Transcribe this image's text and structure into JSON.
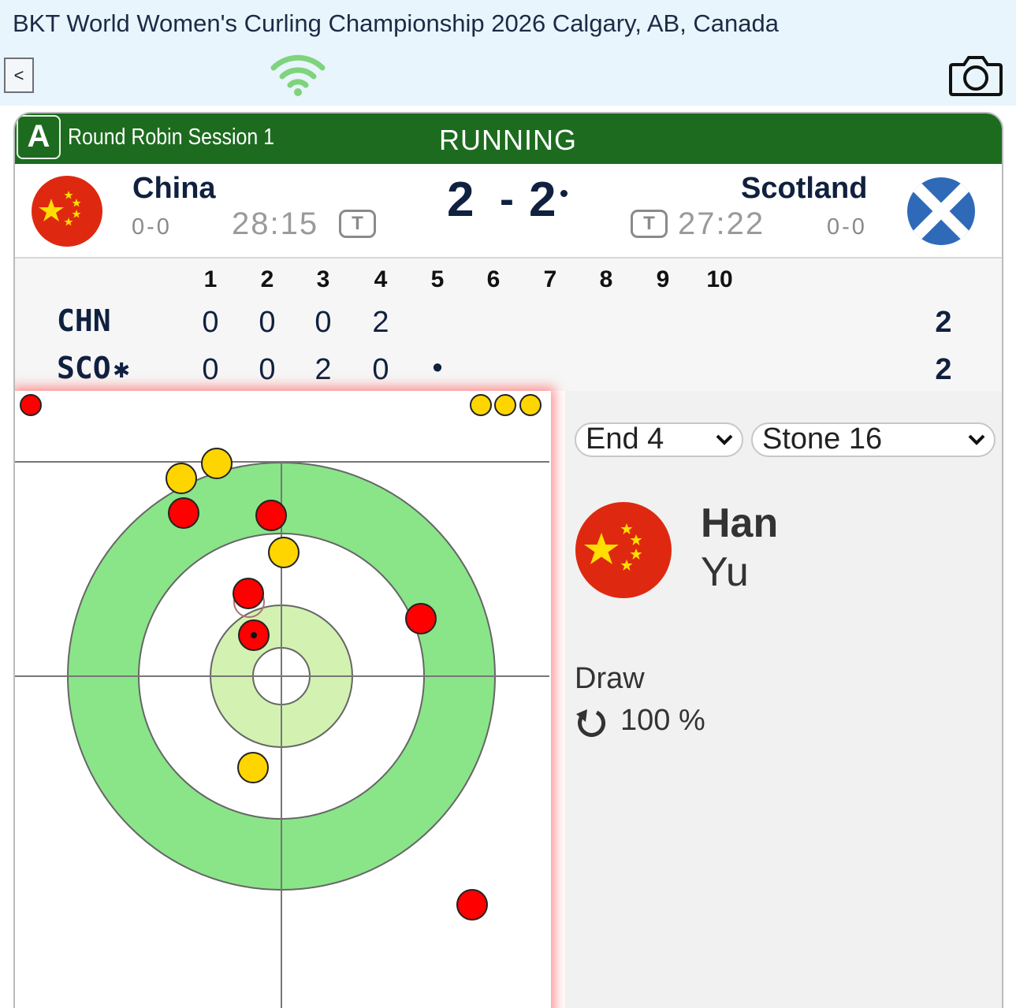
{
  "header": {
    "title": "BKT World Women's Curling Championship 2026 Calgary, AB, Canada",
    "back_label": "<"
  },
  "game": {
    "sheet": "A",
    "session": "Round Robin Session 1",
    "status": "RUNNING",
    "status_color": "#1d6b1f",
    "home": {
      "name": "China",
      "record": "0-0",
      "time": "28:15",
      "timeout_label": "T",
      "score": "2",
      "abbr": "CHN",
      "ends": [
        "0",
        "0",
        "0",
        "2",
        "",
        "",
        "",
        "",
        "",
        ""
      ],
      "total": "2",
      "stone_color": "#ff0000"
    },
    "away": {
      "name": "Scotland",
      "record": "0-0",
      "time": "27:22",
      "timeout_label": "T",
      "score": "2",
      "abbr": "SCO",
      "hammer_mark": "✱",
      "ends": [
        "0",
        "0",
        "2",
        "0",
        "•",
        "",
        "",
        "",
        "",
        ""
      ],
      "total": "2",
      "stone_color": "#ffd500"
    },
    "score_separator": "-",
    "end_numbers": [
      "1",
      "2",
      "3",
      "4",
      "5",
      "6",
      "7",
      "8",
      "9",
      "10"
    ]
  },
  "controls": {
    "end_select": "End 4",
    "stone_select": "Stone 16"
  },
  "player": {
    "first_name": "Han",
    "last_name": "Yu",
    "shot_type": "Draw",
    "rotation_icon": "counter-clockwise-arrow-icon",
    "shot_percent": "100 %"
  },
  "icons": {
    "wifi": "wifi-icon",
    "camera": "camera-icon",
    "china_flag": "china-flag-icon",
    "scotland_flag": "scotland-flag-icon"
  },
  "colors": {
    "twelve_foot": "#8ae589",
    "four_foot": "#d3f2b1",
    "wifi": "#7fd37c"
  }
}
